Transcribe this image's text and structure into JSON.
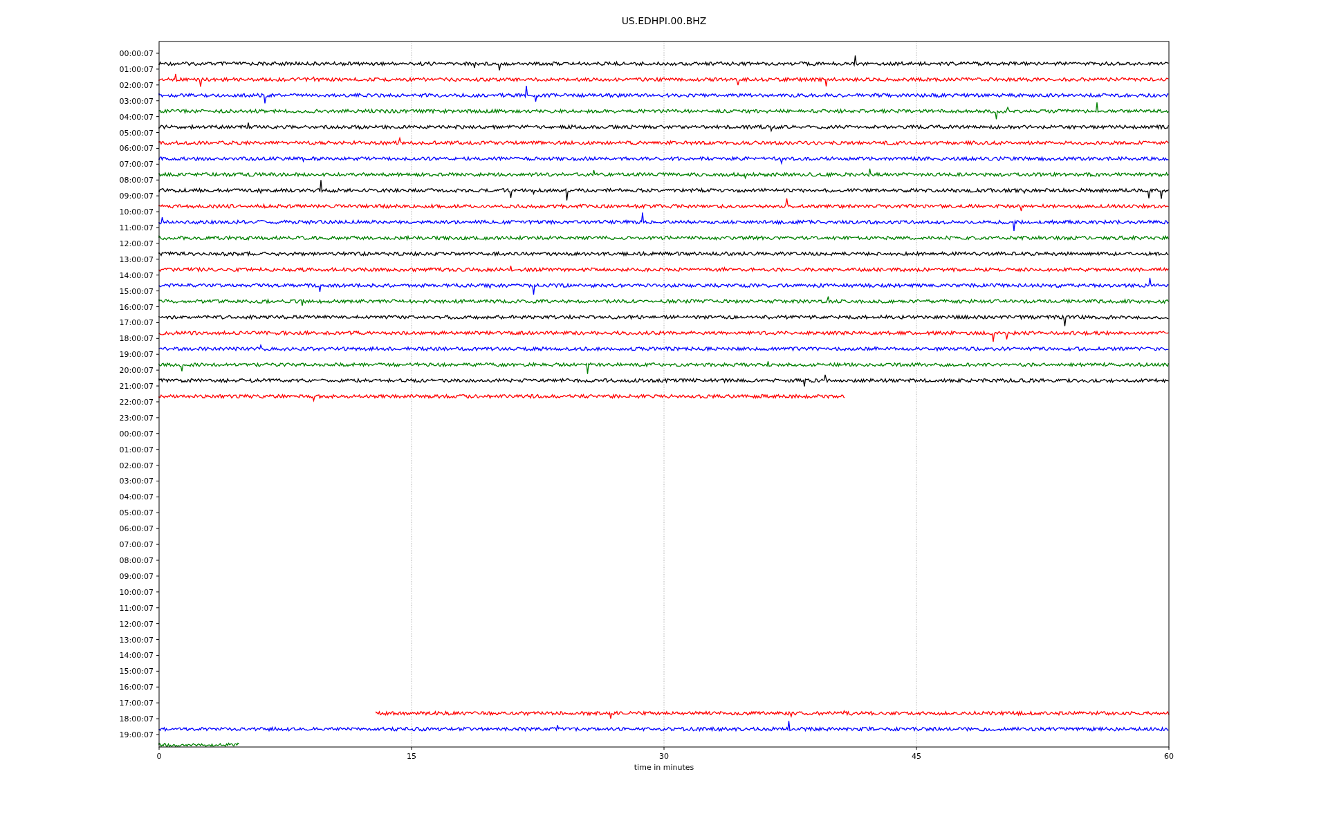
{
  "title": "US.EDHPI.00.BHZ",
  "xlabel": "time in minutes",
  "xticks": [
    "0",
    "15",
    "30",
    "45",
    "60"
  ],
  "rows": [
    {
      "label": "00:00:07",
      "trace": {
        "color": "#000000",
        "level": 1,
        "kind": "start"
      }
    },
    {
      "label": "01:00:07",
      "trace": {
        "color": "#ff0000",
        "level": 1,
        "kind": "start"
      }
    },
    {
      "label": "02:00:07",
      "trace": {
        "color": "#0000ff",
        "level": 1,
        "kind": "start"
      }
    },
    {
      "label": "03:00:07",
      "trace": {
        "color": "#008000",
        "level": 1,
        "kind": "start"
      }
    },
    {
      "label": "04:00:07",
      "trace": {
        "color": "#000000",
        "level": 1,
        "kind": "start"
      }
    },
    {
      "label": "05:00:07",
      "trace": {
        "color": "#ff0000",
        "level": 1,
        "kind": "start"
      }
    },
    {
      "label": "06:00:07",
      "trace": {
        "color": "#0000ff",
        "level": 1,
        "kind": "start"
      }
    },
    {
      "label": "07:00:07",
      "trace": {
        "color": "#008000",
        "level": 1,
        "kind": "start"
      }
    },
    {
      "label": "08:00:07",
      "trace": {
        "color": "#000000",
        "level": 1,
        "kind": "start"
      }
    },
    {
      "label": "09:00:07",
      "trace": {
        "color": "#ff0000",
        "level": 1,
        "kind": "start"
      }
    },
    {
      "label": "10:00:07",
      "trace": {
        "color": "#0000ff",
        "level": 1,
        "kind": "start"
      }
    },
    {
      "label": "11:00:07",
      "trace": {
        "color": "#008000",
        "level": 1,
        "kind": "start"
      }
    },
    {
      "label": "12:00:07",
      "trace": {
        "color": "#000000",
        "level": 1,
        "kind": "start"
      }
    },
    {
      "label": "13:00:07",
      "trace": {
        "color": "#ff0000",
        "level": 1,
        "kind": "start"
      }
    },
    {
      "label": "14:00:07",
      "trace": {
        "color": "#0000ff",
        "level": 1,
        "kind": "start"
      }
    },
    {
      "label": "15:00:07",
      "trace": {
        "color": "#008000",
        "level": 1,
        "kind": "start"
      }
    },
    {
      "label": "16:00:07",
      "trace": {
        "color": "#000000",
        "level": 1,
        "kind": "start"
      }
    },
    {
      "label": "17:00:07",
      "trace": {
        "color": "#ff0000",
        "level": 1,
        "kind": "start"
      }
    },
    {
      "label": "18:00:07",
      "trace": {
        "color": "#0000ff",
        "level": 1,
        "kind": "start"
      }
    },
    {
      "label": "19:00:07",
      "trace": {
        "color": "#008000",
        "level": 1,
        "kind": "start"
      }
    },
    {
      "label": "20:00:07",
      "trace": {
        "color": "#000000",
        "level": 1,
        "kind": "start"
      }
    },
    {
      "label": "21:00:07",
      "trace": {
        "color": "#ff0000",
        "level": 0.68,
        "kind": "start"
      }
    },
    {
      "label": "22:00:07"
    },
    {
      "label": "23:00:07"
    },
    {
      "label": "00:00:07"
    },
    {
      "label": "01:00:07"
    },
    {
      "label": "02:00:07"
    },
    {
      "label": "03:00:07"
    },
    {
      "label": "04:00:07"
    },
    {
      "label": "05:00:07"
    },
    {
      "label": "06:00:07"
    },
    {
      "label": "07:00:07"
    },
    {
      "label": "08:00:07"
    },
    {
      "label": "09:00:07"
    },
    {
      "label": "10:00:07"
    },
    {
      "label": "11:00:07"
    },
    {
      "label": "12:00:07"
    },
    {
      "label": "13:00:07"
    },
    {
      "label": "14:00:07"
    },
    {
      "label": "15:00:07"
    },
    {
      "label": "16:00:07"
    },
    {
      "label": "17:00:07",
      "trace": {
        "color": "#ff0000",
        "level": 0.785,
        "kind": "end"
      }
    },
    {
      "label": "18:00:07",
      "trace": {
        "color": "#0000ff",
        "level": 1,
        "kind": "start"
      }
    },
    {
      "label": "19:00:07",
      "trace": {
        "color": "#008000",
        "level": 0.08,
        "kind": "start"
      }
    }
  ]
}
